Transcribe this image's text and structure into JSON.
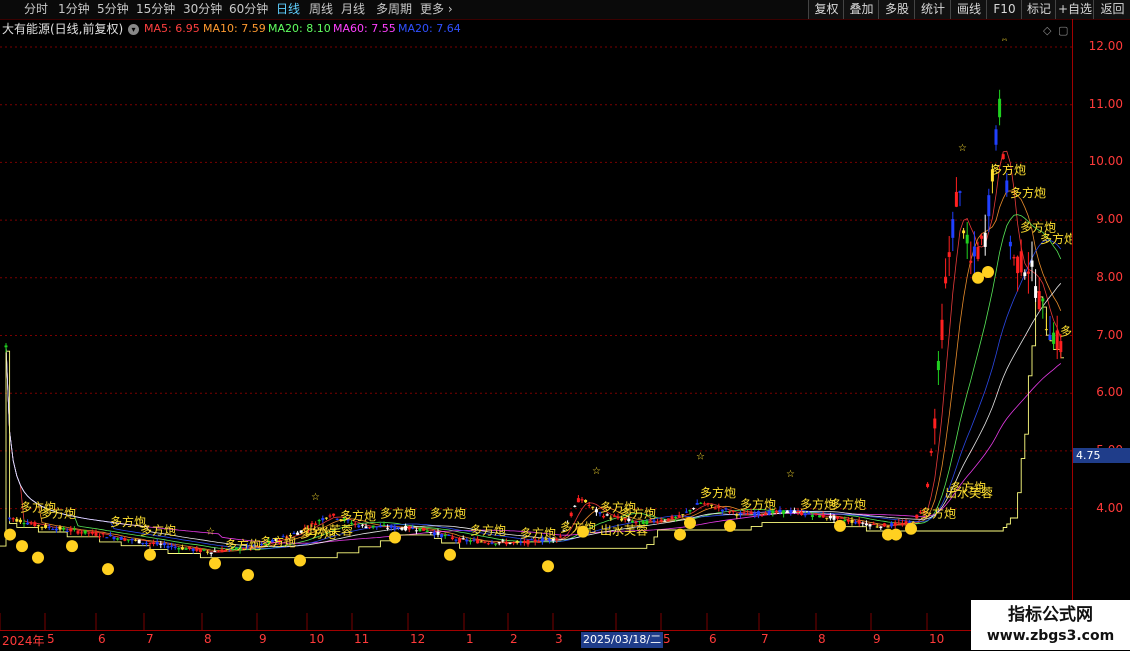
{
  "toolbar": {
    "periods": [
      {
        "label": "分时",
        "active": false
      },
      {
        "label": "1分钟",
        "active": false
      },
      {
        "label": "5分钟",
        "active": false
      },
      {
        "label": "15分钟",
        "active": false
      },
      {
        "label": "30分钟",
        "active": false
      },
      {
        "label": "60分钟",
        "active": false
      },
      {
        "label": "日线",
        "active": true
      },
      {
        "label": "周线",
        "active": false
      },
      {
        "label": "月线",
        "active": false
      },
      {
        "label": "多周期",
        "active": false
      },
      {
        "label": "更多",
        "active": false
      }
    ],
    "actions": [
      "复权",
      "叠加",
      "多股",
      "统计",
      "画线",
      "F10",
      "标记",
      "+自选",
      "返回"
    ]
  },
  "legend": {
    "title": "大有能源(日线,前复权)",
    "ma": [
      {
        "label": "MA5: 6.95",
        "color": "#ff4040"
      },
      {
        "label": "MA10: 7.59",
        "color": "#ff9a30"
      },
      {
        "label": "MA20: 8.10",
        "color": "#60ff60"
      },
      {
        "label": "MA60: 7.55",
        "color": "#ff40ff"
      },
      {
        "label": "MA20: 7.64",
        "color": "#3050ff"
      }
    ]
  },
  "price_axis": {
    "ticks": [
      "12.00",
      "11.00",
      "10.00",
      "9.00",
      "8.00",
      "7.00",
      "6.00",
      "5.00",
      "4.00"
    ],
    "current_price": "4.75"
  },
  "date_axis": {
    "labels": [
      "2024年",
      "5",
      "6",
      "7",
      "8",
      "9",
      "10",
      "11",
      "12",
      "1",
      "2",
      "3",
      "4",
      "5",
      "6",
      "7",
      "8",
      "9",
      "10"
    ],
    "cursor_date": "2025/03/18/二"
  },
  "watermark": {
    "title": "指标公式网",
    "url": "www.zbgs3.com"
  },
  "chart_data": {
    "type": "candlestick",
    "title": "大有能源(日线,前复权)",
    "ylim": [
      3.0,
      12.2
    ],
    "grid": true,
    "yticks": [
      4,
      5,
      6,
      7,
      8,
      9,
      10,
      11,
      12
    ],
    "months": [
      "2024年",
      "5",
      "6",
      "7",
      "8",
      "9",
      "10",
      "11",
      "12",
      "1",
      "2",
      "3",
      "4",
      "5",
      "6",
      "7",
      "8",
      "9",
      "10"
    ],
    "series": [
      {
        "name": "MA5",
        "last": 6.95,
        "color": "#ff4040"
      },
      {
        "name": "MA10",
        "last": 7.59,
        "color": "#ff9a30"
      },
      {
        "name": "MA20",
        "last": 8.1,
        "color": "#60ff60"
      },
      {
        "name": "MA60",
        "last": 7.55,
        "color": "#ff40ff"
      },
      {
        "name": "MA20",
        "last": 7.64,
        "color": "#3050ff"
      }
    ],
    "key_closes": [
      {
        "month": "2024年",
        "close": 3.8
      },
      {
        "month": "5",
        "close": 3.6
      },
      {
        "month": "6",
        "close": 3.5
      },
      {
        "month": "7",
        "close": 3.4
      },
      {
        "month": "8",
        "close": 3.3
      },
      {
        "month": "9",
        "close": 3.4
      },
      {
        "month": "10",
        "close": 3.7
      },
      {
        "month": "11",
        "close": 3.6
      },
      {
        "month": "12",
        "close": 3.6
      },
      {
        "month": "1",
        "close": 3.4
      },
      {
        "month": "2",
        "close": 3.6
      },
      {
        "month": "3",
        "close": 3.9
      },
      {
        "month": "4",
        "close": 3.7
      },
      {
        "month": "5",
        "close": 3.8
      },
      {
        "month": "6",
        "close": 4.0
      },
      {
        "month": "7",
        "close": 4.0
      },
      {
        "month": "8",
        "close": 3.9
      },
      {
        "month": "9",
        "close": 3.9
      },
      {
        "month": "10",
        "close": 5.5
      },
      {
        "month": "10",
        "close": 10.0
      },
      {
        "month": "10",
        "close": 8.5
      },
      {
        "month": "10",
        "close": 12.0
      },
      {
        "month": "10",
        "close": 8.0
      },
      {
        "month": "10",
        "close": 7.0
      }
    ],
    "annotations": [
      "多方炮",
      "出水芙蓉"
    ]
  }
}
